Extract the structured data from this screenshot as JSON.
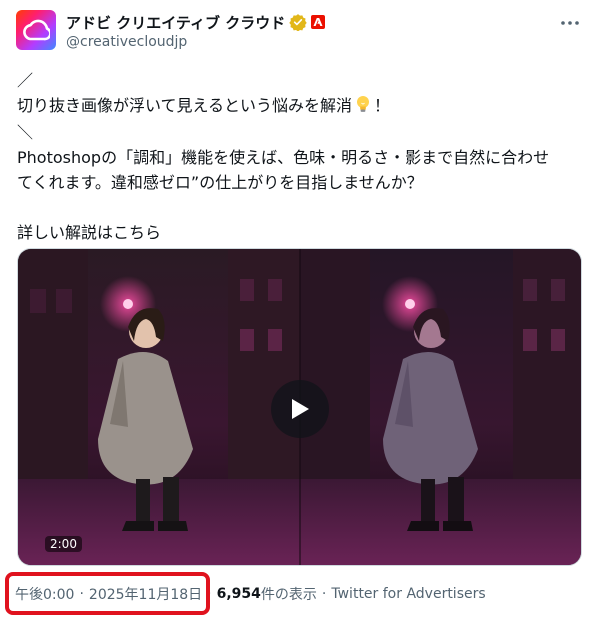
{
  "author": {
    "display_name": "アドビ クリエイティブ クラウド",
    "handle": "@creativecloudjp",
    "avatar_icon": "creative-cloud-logo",
    "verified_icon": "gold-verified-badge",
    "affiliate_icon": "adobe-logo",
    "more_icon": "more-horizontal-icon"
  },
  "tweet": {
    "line1": "／",
    "line2": "切り抜き画像が浮いて見えるという悩みを解消",
    "line2_suffix": "！",
    "line3": "＼",
    "line4": "Photoshopの「調和」機能を使えば、色味・明るさ・影まで自然に合わせ",
    "line5": "てくれます。違和感ゼロ”の仕上がりを目指しませんか？",
    "line6": "詳しい解説はこちら",
    "emoji_icon": "light-bulb-icon"
  },
  "media": {
    "duration": "2:00",
    "play_icon": "play-icon"
  },
  "meta": {
    "time": "午後0:00",
    "date": "2025年11月18日",
    "views_count": "6,954",
    "views_label": " 件の表示",
    "source": "Twitter for Advertisers",
    "separator": "·"
  },
  "colors": {
    "text": "#0f1419",
    "secondary": "#536471",
    "highlight": "#e0121e",
    "adobe_red": "#eb1000",
    "verified_gold": "#e2b719"
  }
}
